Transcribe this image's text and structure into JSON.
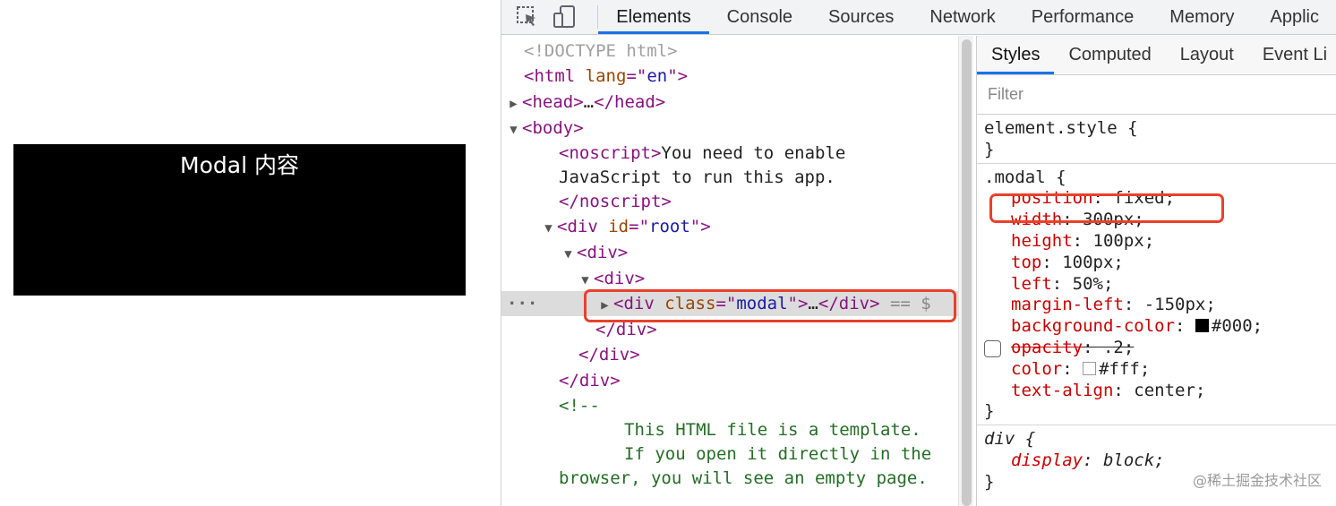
{
  "modal": {
    "text": "Modal 内容"
  },
  "devtools": {
    "tabs": [
      "Elements",
      "Console",
      "Sources",
      "Network",
      "Performance",
      "Memory",
      "Applic"
    ],
    "active_tab": "Elements",
    "icons": [
      "inspect-element-icon",
      "device-toolbar-icon"
    ]
  },
  "tree": {
    "doctype": "<!DOCTYPE html>",
    "html_tag": "html",
    "html_attr": "lang",
    "html_val": "en",
    "head_tag": "head",
    "head_close": "</head>",
    "ellipsis": "…",
    "body_tag": "body",
    "noscript_tag": "noscript",
    "noscript_text1": "You need to enable",
    "noscript_text2": "JavaScript to run this app.",
    "noscript_close": "</noscript>",
    "div_tag": "div",
    "root_attr": "id",
    "root_val": "root",
    "class_attr": "class",
    "modal_val": "modal",
    "div_close": "</div>",
    "selected_suffix": " == $",
    "comment_open": "<!--",
    "comment1": "This HTML file is a template.",
    "comment2": "If you open it directly in the",
    "comment3": "browser, you will see an empty page."
  },
  "styles_pane": {
    "tabs": [
      "Styles",
      "Computed",
      "Layout",
      "Event Li"
    ],
    "active_tab": "Styles",
    "filter_placeholder": "Filter",
    "element_style": "element.style {",
    "close_brace": "}",
    "modal_selector": ".modal {",
    "modal_props": [
      {
        "name": "position",
        "value": "fixed;"
      },
      {
        "name": "width",
        "value": "300px;"
      },
      {
        "name": "height",
        "value": "100px;"
      },
      {
        "name": "top",
        "value": "100px;"
      },
      {
        "name": "left",
        "value": "50%;"
      },
      {
        "name": "margin-left",
        "value": "-150px;"
      },
      {
        "name": "background-color",
        "value": "#000;"
      },
      {
        "name": "opacity",
        "value": ".2;"
      },
      {
        "name": "color",
        "value": "#fff;"
      },
      {
        "name": "text-align",
        "value": "center;"
      }
    ],
    "div_selector": "div {",
    "div_props": [
      {
        "name": "display",
        "value": "block;"
      }
    ]
  },
  "colors": {
    "highlight": "#e8412b",
    "accent": "#1a73e8",
    "swatch_black": "#000000",
    "swatch_white": "#ffffff"
  },
  "watermark": "@稀土掘金技术社区"
}
